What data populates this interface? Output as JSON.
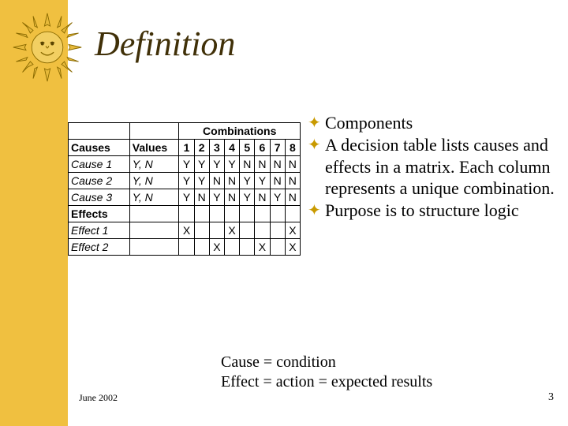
{
  "title": "Definition",
  "sun_icon": "sun-icon",
  "table": {
    "combinations_label": "Combinations",
    "causes_label": "Causes",
    "values_label": "Values",
    "effects_label": "Effects",
    "cols": [
      "1",
      "2",
      "3",
      "4",
      "5",
      "6",
      "7",
      "8"
    ],
    "causes": [
      {
        "name": "Cause 1",
        "values": "Y, N",
        "cells": [
          "Y",
          "Y",
          "Y",
          "Y",
          "N",
          "N",
          "N",
          "N"
        ]
      },
      {
        "name": "Cause 2",
        "values": "Y, N",
        "cells": [
          "Y",
          "Y",
          "N",
          "N",
          "Y",
          "Y",
          "N",
          "N"
        ]
      },
      {
        "name": "Cause 3",
        "values": "Y, N",
        "cells": [
          "Y",
          "N",
          "Y",
          "N",
          "Y",
          "N",
          "Y",
          "N"
        ]
      }
    ],
    "effects": [
      {
        "name": "Effect 1",
        "cells": [
          "X",
          "",
          "",
          "X",
          "",
          "",
          "",
          "X"
        ]
      },
      {
        "name": "Effect 2",
        "cells": [
          "",
          "",
          "X",
          "",
          "",
          "X",
          "",
          "X"
        ]
      }
    ]
  },
  "bullets": [
    "Components",
    "A decision table lists causes and effects in a matrix.  Each column represents a unique combination.",
    "Purpose is to structure logic"
  ],
  "equations": [
    "Cause = condition",
    "Effect = action = expected results"
  ],
  "footer": {
    "date": "June 2002",
    "page": "3"
  }
}
